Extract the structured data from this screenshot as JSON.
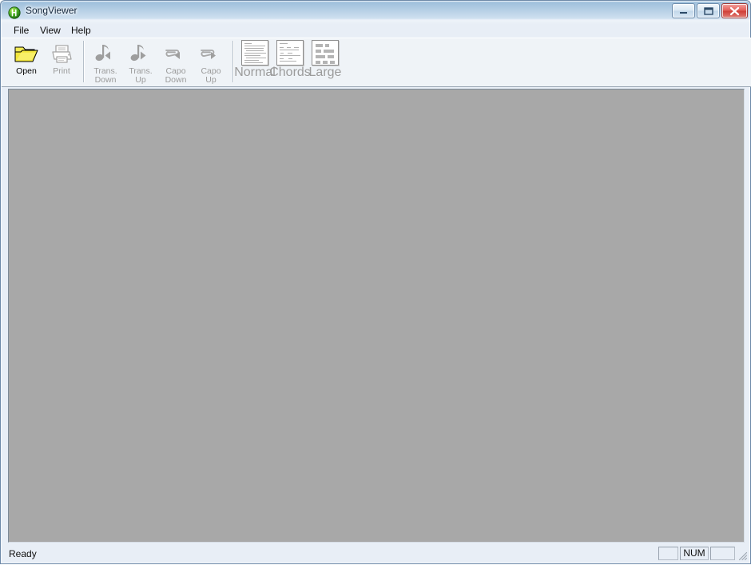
{
  "window": {
    "title": "SongViewer",
    "app_icon": "songviewer-note-icon",
    "controls": [
      {
        "name": "minimize",
        "icon": "minimize-icon"
      },
      {
        "name": "maximize",
        "icon": "maximize-icon"
      },
      {
        "name": "close",
        "icon": "close-icon"
      }
    ]
  },
  "menubar": {
    "items": [
      {
        "label": "File"
      },
      {
        "label": "View"
      },
      {
        "label": "Help"
      }
    ]
  },
  "toolbar": {
    "groups": [
      {
        "name": "file-group",
        "buttons": [
          {
            "label": "Open",
            "icon": "open-folder-icon",
            "enabled": true
          },
          {
            "label": "Print",
            "icon": "printer-icon",
            "enabled": false
          }
        ]
      },
      {
        "name": "transpose-capo-group",
        "buttons": [
          {
            "label": "Trans.\nDown",
            "icon": "note-left-arrow-icon",
            "enabled": false
          },
          {
            "label": "Trans.\nUp",
            "icon": "note-right-arrow-icon",
            "enabled": false
          },
          {
            "label": "Capo\nDown",
            "icon": "capo-left-arrow-icon",
            "enabled": false
          },
          {
            "label": "Capo\nUp",
            "icon": "capo-right-arrow-icon",
            "enabled": false
          }
        ]
      },
      {
        "name": "view-mode-group",
        "buttons": [
          {
            "label": "Normal",
            "icon": "page-normal-icon",
            "enabled": false
          },
          {
            "label": "Chords",
            "icon": "page-chords-icon",
            "enabled": false
          },
          {
            "label": "Large",
            "icon": "page-large-icon",
            "enabled": false
          }
        ]
      }
    ]
  },
  "client": {
    "background_color": "#a8a8a8",
    "content": ""
  },
  "statusbar": {
    "message": "Ready",
    "panes": [
      {
        "name": "pane-1",
        "label": ""
      },
      {
        "name": "pane-num",
        "label": "NUM"
      },
      {
        "name": "pane-3",
        "label": ""
      }
    ],
    "grip": "resize-grip-icon"
  },
  "colors": {
    "titlebar_blue": "#9fc0dc",
    "toolbar_bg": "#eff3f7",
    "client_gray": "#a8a8a8",
    "folder_yellow": "#f2e63c",
    "close_red": "#cf3f38",
    "disabled_gray": "#9b9b9b"
  }
}
